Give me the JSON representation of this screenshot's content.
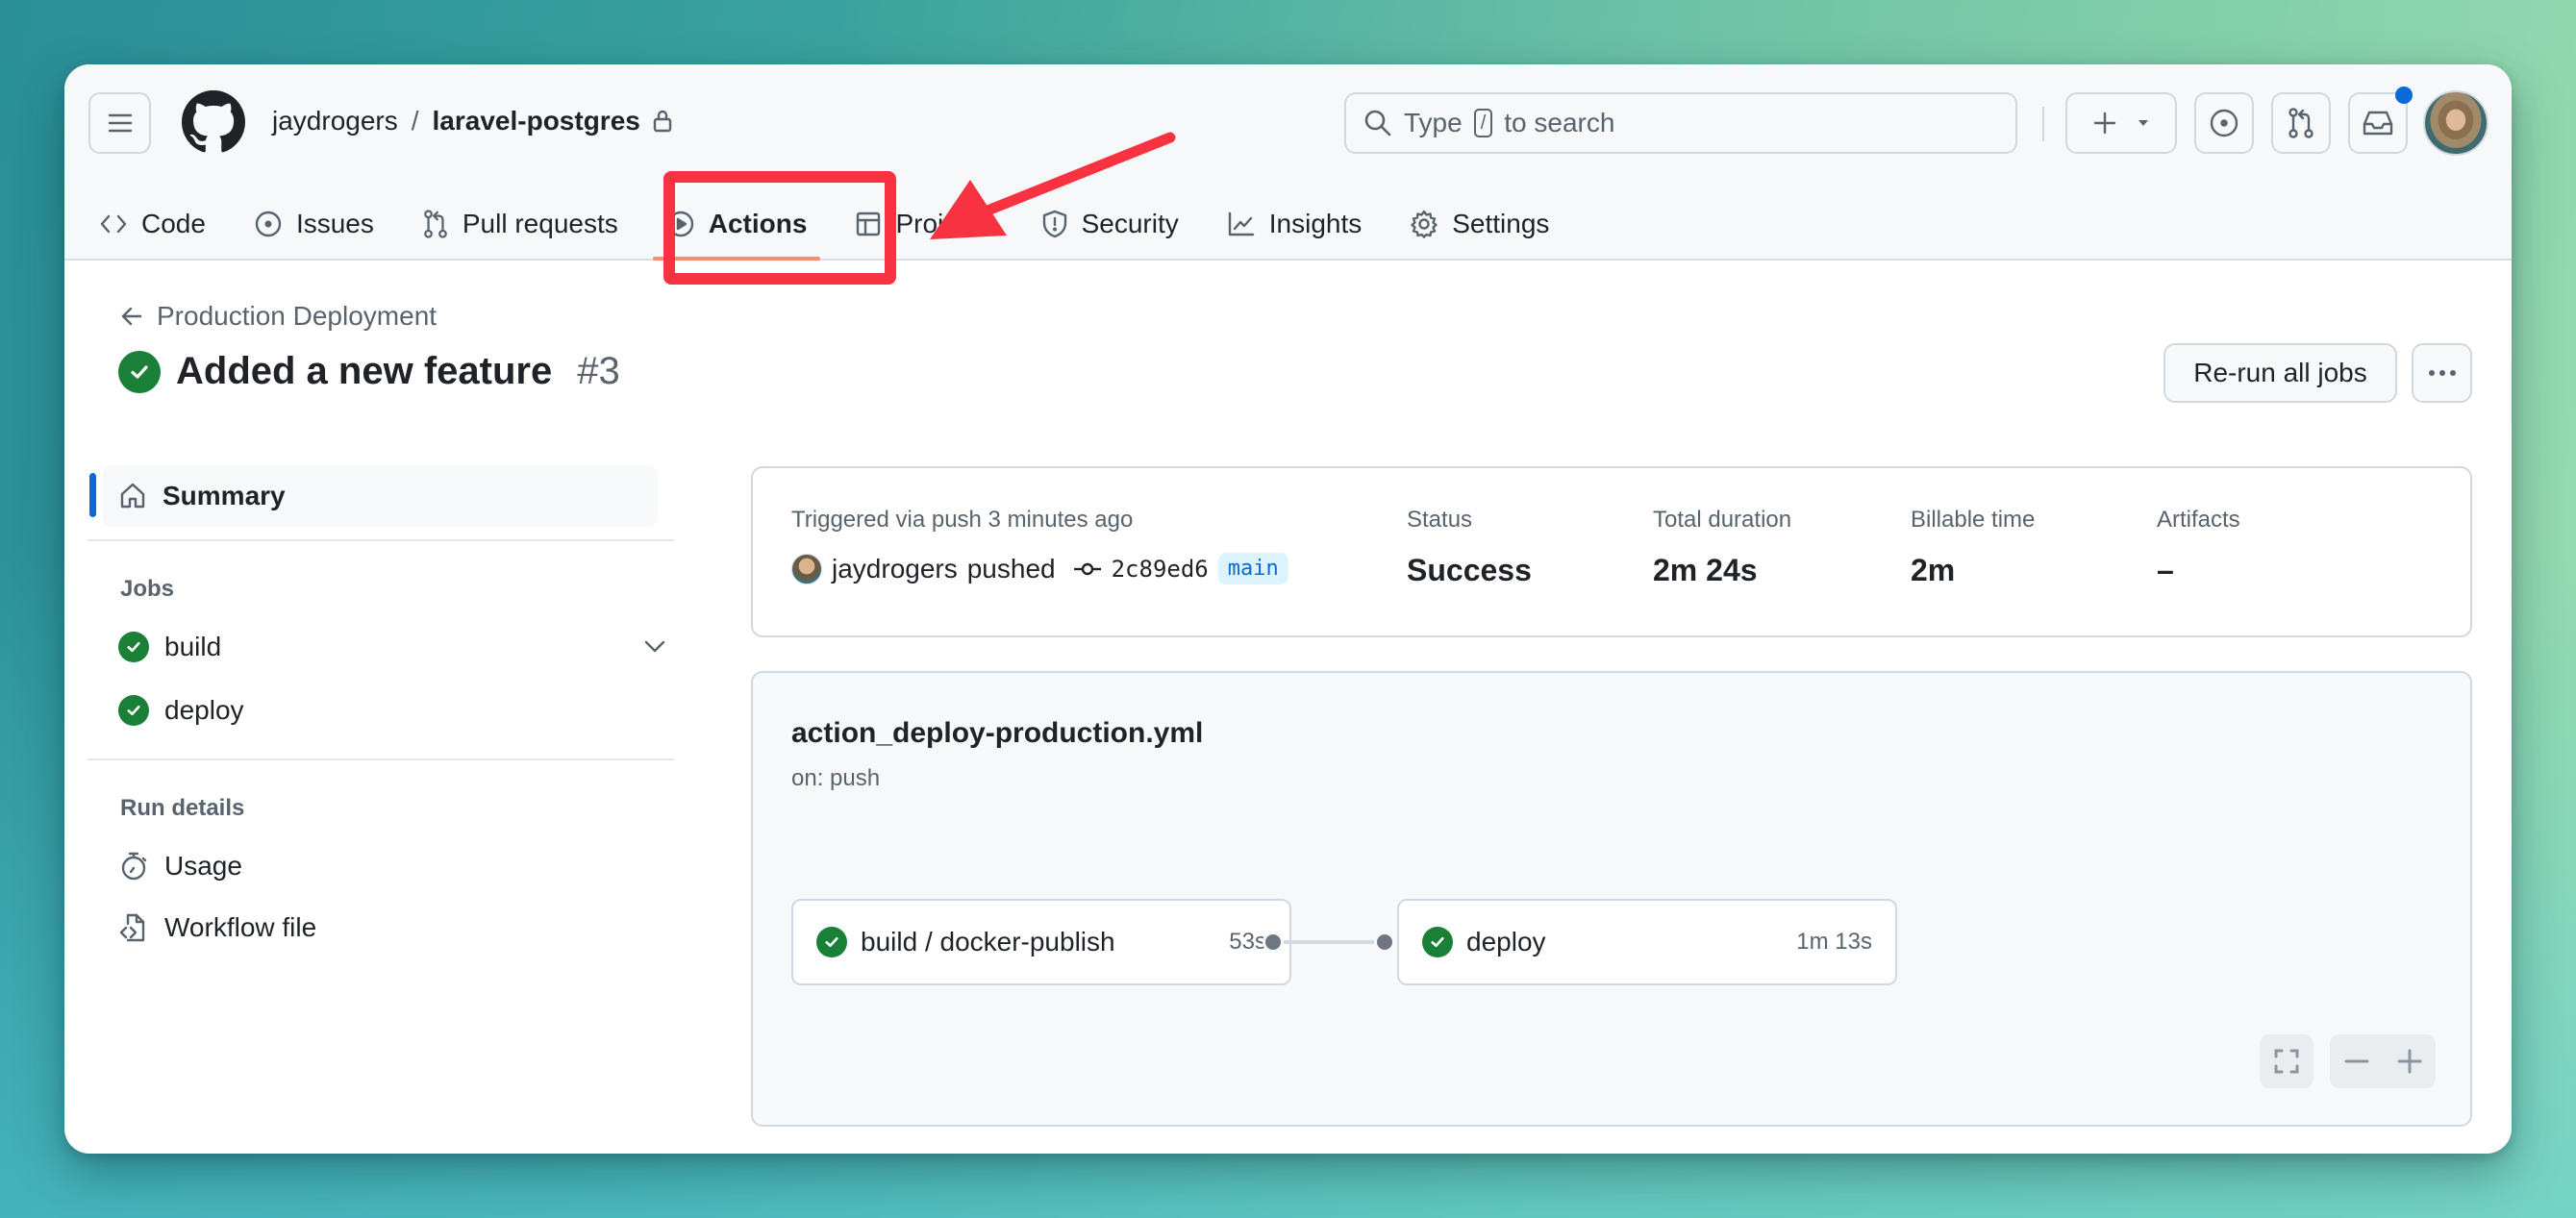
{
  "repo": {
    "owner": "jaydrogers",
    "separator": "/",
    "name": "laravel-postgres",
    "visibility_icon": "lock-icon"
  },
  "search": {
    "placeholder_prefix": "Type",
    "shortcut_key": "/",
    "placeholder_suffix": "to search"
  },
  "header_actions": {
    "create_icon": "plus-icon",
    "issues_icon": "issue-opened-icon",
    "pull_requests_icon": "git-pull-request-icon",
    "inbox_icon": "inbox-icon",
    "has_notifications": true,
    "notification_color": "#0969da"
  },
  "tabs": [
    {
      "label": "Code",
      "icon": "code-icon"
    },
    {
      "label": "Issues",
      "icon": "issue-opened-icon"
    },
    {
      "label": "Pull requests",
      "icon": "git-pull-request-icon"
    },
    {
      "label": "Actions",
      "icon": "play-icon",
      "active": true
    },
    {
      "label": "Projects",
      "icon": "table-icon"
    },
    {
      "label": "Security",
      "icon": "shield-icon"
    },
    {
      "label": "Insights",
      "icon": "graph-icon"
    },
    {
      "label": "Settings",
      "icon": "gear-icon"
    }
  ],
  "annotation": {
    "highlight_target": "Actions",
    "color": "#f93241"
  },
  "run": {
    "back_label": "Production Deployment",
    "title": "Added a new feature",
    "number": "#3",
    "status_color": "#1a7f37",
    "rerun_label": "Re-run all jobs"
  },
  "sidebar": {
    "summary_label": "Summary",
    "jobs_heading": "Jobs",
    "jobs": [
      {
        "label": "build",
        "status": "success",
        "expandable": true
      },
      {
        "label": "deploy",
        "status": "success"
      }
    ],
    "run_details_heading": "Run details",
    "run_details": [
      {
        "label": "Usage",
        "icon": "stopwatch-icon"
      },
      {
        "label": "Workflow file",
        "icon": "file-code-icon"
      }
    ]
  },
  "summary": {
    "trigger_text": "Triggered via push 3 minutes ago",
    "actor": "jaydrogers",
    "action": "pushed",
    "commit_sha": "2c89ed6",
    "branch": "main",
    "status_label": "Status",
    "status_value": "Success",
    "duration_label": "Total duration",
    "duration_value": "2m 24s",
    "billable_label": "Billable time",
    "billable_value": "2m",
    "artifacts_label": "Artifacts",
    "artifacts_value": "–"
  },
  "workflow": {
    "file_name": "action_deploy-production.yml",
    "trigger": "on: push",
    "jobs": [
      {
        "name": "build / docker-publish",
        "duration": "53s",
        "status": "success"
      },
      {
        "name": "deploy",
        "duration": "1m 13s",
        "status": "success"
      }
    ]
  }
}
